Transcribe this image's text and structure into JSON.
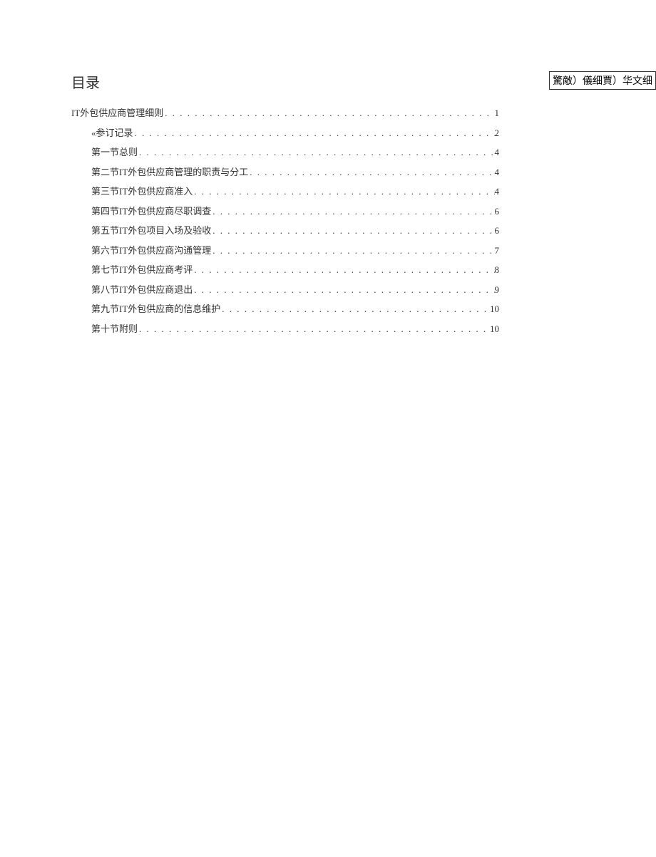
{
  "toc_title": "目录",
  "side_label": "驚敵）儀细賈）华文细",
  "entries": [
    {
      "level": 1,
      "label": "IT外包供应商管理细则",
      "page": "1"
    },
    {
      "level": 2,
      "label": "«参订记录",
      "page": "2"
    },
    {
      "level": 2,
      "label": "第一节总则",
      "page": "4"
    },
    {
      "level": 2,
      "label": "第二节IT外包供应商管理的职责与分工",
      "page": "4"
    },
    {
      "level": 2,
      "label": "第三节IT外包供应商准入",
      "page": "4"
    },
    {
      "level": 2,
      "label": "第四节IT外包供应商尽职调查",
      "page": "6"
    },
    {
      "level": 2,
      "label": "第五节IT外包项目入场及验收",
      "page": "6"
    },
    {
      "level": 2,
      "label": "第六节IT外包供应商沟通管理",
      "page": "7"
    },
    {
      "level": 2,
      "label": "第七节IT外包供应商考评",
      "page": "8"
    },
    {
      "level": 2,
      "label": "第八节IT外包供应商退出",
      "page": "9"
    },
    {
      "level": 2,
      "label": "第九节IT外包供应商的信息维护",
      "page": "10"
    },
    {
      "level": 2,
      "label": "第十节附则",
      "page": "10"
    }
  ]
}
